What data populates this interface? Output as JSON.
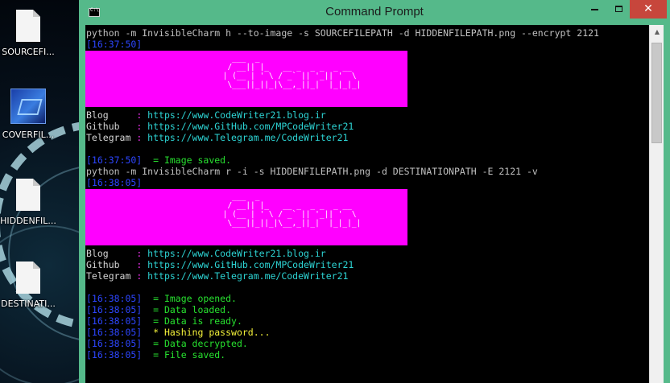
{
  "desktop": {
    "icons": [
      {
        "label": "SOURCEFI...",
        "icon": "file-icon"
      },
      {
        "label": "COVERFIL...",
        "icon": "image-icon"
      },
      {
        "label": "HIDDENFIL...",
        "icon": "file-icon"
      },
      {
        "label": "DESTINATI...",
        "icon": "file-icon"
      }
    ]
  },
  "window": {
    "title": "Command Prompt",
    "controls": {
      "minimize": "minimize",
      "maximize": "maximize",
      "close": "✕"
    }
  },
  "console": {
    "cmd1": "python -m InvisibleCharm h --to-image -s SOURCEFILEPATH -d HIDDENFILEPATH.png --encrypt 2121",
    "ts1": "[16:37:50]",
    "banner_art": "   ___  _                             \n  / __|| |_   __ _  _ _  _ __          \n | (__ | ' \\ / _` || '_|| '  \\         \n  \\___||_||_|\\__,_||_|  |_|_|_|        ",
    "links": [
      {
        "key": "Blog    ",
        "sep": " : ",
        "url": "https://www.CodeWriter21.blog.ir"
      },
      {
        "key": "Github  ",
        "sep": " : ",
        "url": "https://www.GitHub.com/MPCodeWriter21"
      },
      {
        "key": "Telegram",
        "sep": " : ",
        "url": "https://www.Telegram.me/CodeWriter21"
      }
    ],
    "ts2": "[16:37:50]",
    "saved": "  = Image saved.",
    "cmd2": "python -m InvisibleCharm r -i -s HIDDENFILEPATH.png -d DESTINATIONPATH -E 2121 -v",
    "ts3": "[16:38:05]",
    "log": [
      {
        "ts": "[16:38:05]",
        "text": "  = Image opened.",
        "level": "ok"
      },
      {
        "ts": "[16:38:05]",
        "text": "  = Data loaded.",
        "level": "ok"
      },
      {
        "ts": "[16:38:05]",
        "text": "  = Data is ready.",
        "level": "ok"
      },
      {
        "ts": "[16:38:05]",
        "text": "  * Hashing password...",
        "level": "warn"
      },
      {
        "ts": "[16:38:05]",
        "text": "  = Data decrypted.",
        "level": "ok"
      },
      {
        "ts": "[16:38:05]",
        "text": "  = File saved.",
        "level": "ok"
      }
    ]
  },
  "colors": {
    "console_bg": "#000000",
    "banner": "#ff00ff",
    "timestamp": "#2d46ff",
    "success": "#27e02f",
    "warning": "#f3f13a",
    "link": "#2dd4d4",
    "window_frame": "#55b98a",
    "close_button": "#c7463c"
  }
}
